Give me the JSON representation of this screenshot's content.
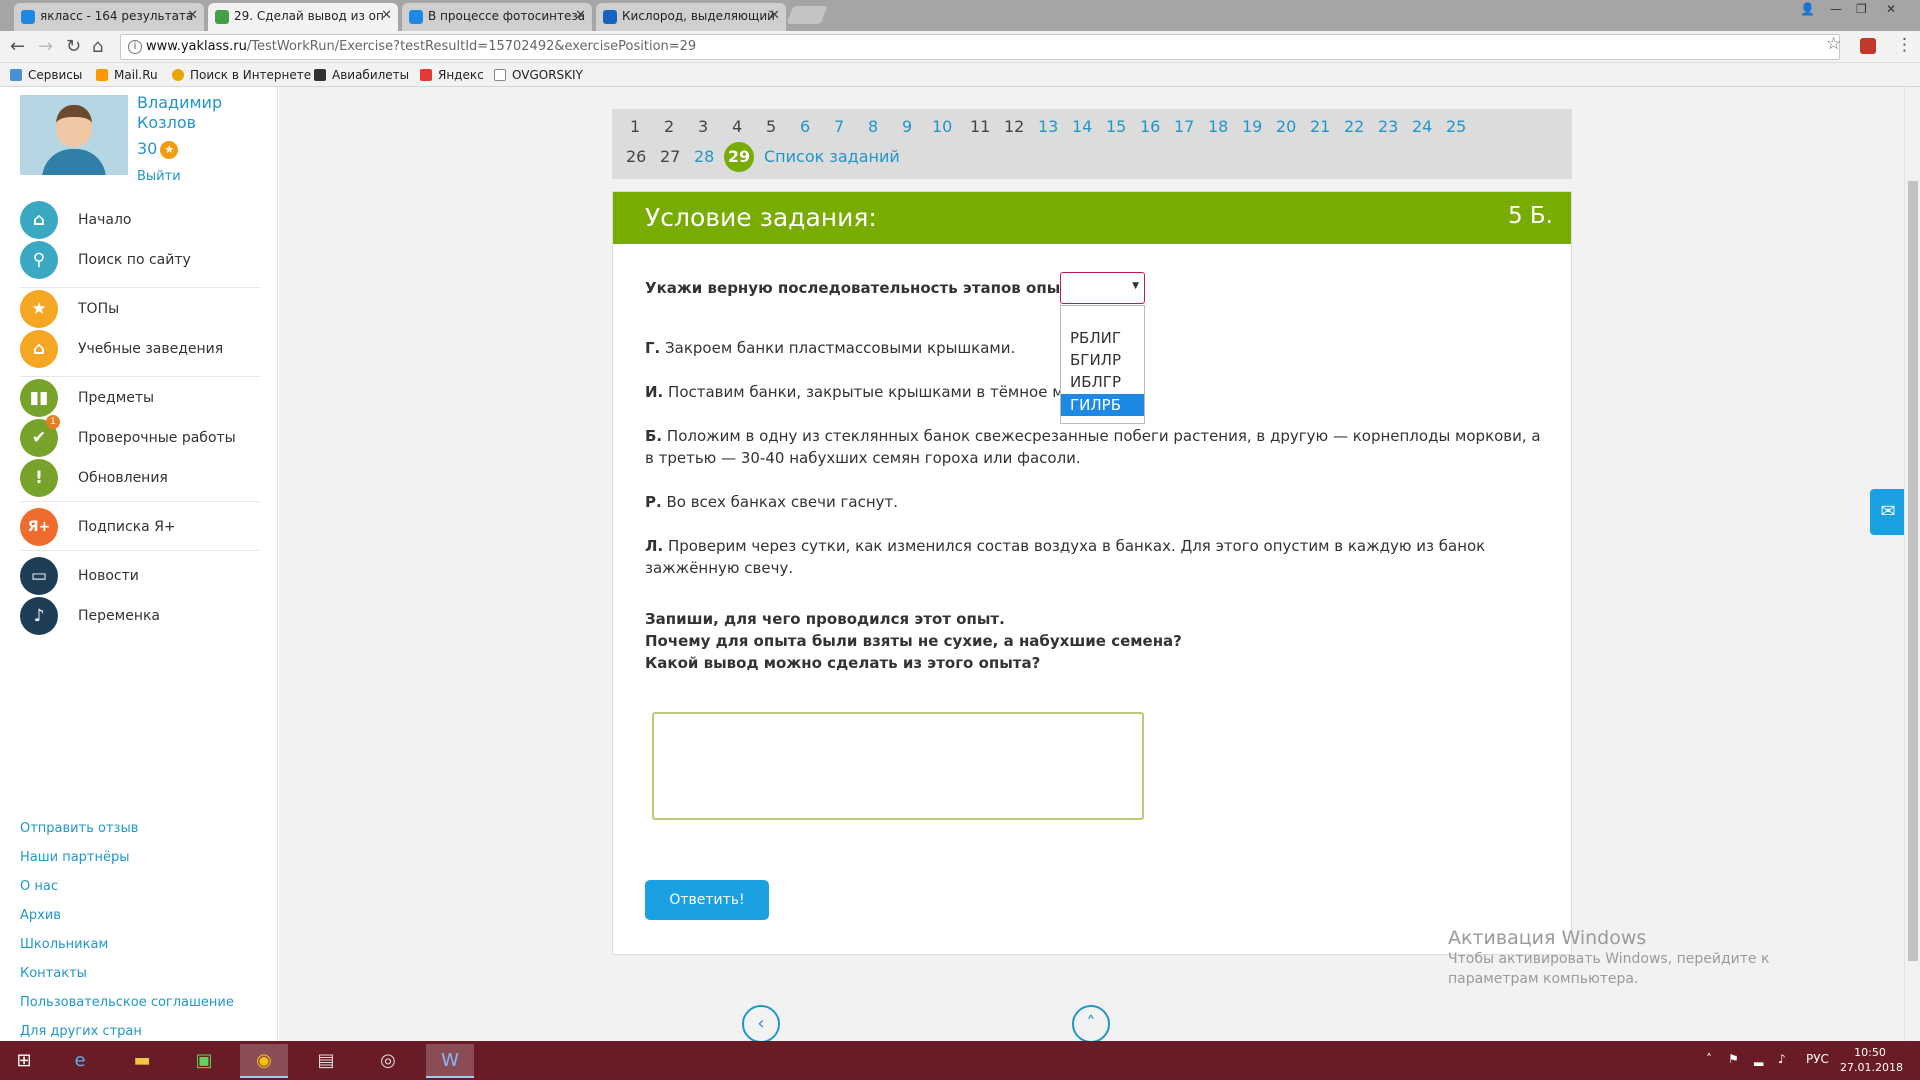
{
  "browser": {
    "tabs": [
      {
        "title": "яклacc - 164 результата",
        "active": false
      },
      {
        "title": "29. Сделай вывод из оп",
        "active": true
      },
      {
        "title": "В процессе фотосинтеза",
        "active": false
      },
      {
        "title": "Кислород, выделяющий",
        "active": false
      }
    ],
    "url_host": "www.yaklass.ru",
    "url_path": "/TestWorkRun/Exercise?testResultId=15702492&exercisePosition=29",
    "bookmarks": [
      "Сервисы",
      "Mail.Ru",
      "Поиск в Интернете",
      "Авиабилеты",
      "Яндекс",
      "OVGORSKIY"
    ]
  },
  "user": {
    "first_name": "Владимир",
    "last_name": "Козлов",
    "points": "30",
    "logout": "Выйти"
  },
  "sidebar": {
    "items": [
      {
        "label": "Начало",
        "icon": "home-icon",
        "color": "#3aa8c1"
      },
      {
        "label": "Поиск по сайту",
        "icon": "search-icon",
        "color": "#3aa8c1"
      },
      {
        "label": "ТОПы",
        "icon": "star-icon",
        "color": "#f5a623"
      },
      {
        "label": "Учебные заведения",
        "icon": "school-icon",
        "color": "#f5a623"
      },
      {
        "label": "Предметы",
        "icon": "book-icon",
        "color": "#78a32b"
      },
      {
        "label": "Проверочные работы",
        "icon": "check-icon",
        "color": "#78a32b",
        "badge": "1"
      },
      {
        "label": "Обновления",
        "icon": "exclamation-icon",
        "color": "#78a32b"
      },
      {
        "label": "Подписка Я+",
        "icon": "ya-plus-icon",
        "color": "#ef6c2d"
      },
      {
        "label": "Новости",
        "icon": "chat-icon",
        "color": "#1f3d56"
      },
      {
        "label": "Переменка",
        "icon": "bell-icon",
        "color": "#1f3d56"
      }
    ],
    "footer_links": [
      "Отправить отзыв",
      "Наши партнёры",
      "О нас",
      "Архив",
      "Школьникам",
      "Контакты",
      "Пользовательское соглашение",
      "Для других стран"
    ]
  },
  "pager": {
    "row1": [
      "1",
      "2",
      "3",
      "4",
      "5",
      "6",
      "7",
      "8",
      "9",
      "10",
      "11",
      "12",
      "13",
      "14",
      "15",
      "16",
      "17",
      "18",
      "19",
      "20",
      "21",
      "22",
      "23",
      "24",
      "25"
    ],
    "row2": [
      "26",
      "27",
      "28"
    ],
    "current": "29",
    "task_list": "Список заданий"
  },
  "task": {
    "header": "Условие задания:",
    "points": "5 Б.",
    "prompt": "Укажи верную последовательность этапов опыта:",
    "select_value": "",
    "options": [
      "РБЛИГ",
      "БГИЛР",
      "ИБЛГР",
      "ГИЛРБ"
    ],
    "highlighted_option": "ГИЛРБ",
    "steps": [
      {
        "letter": "Г.",
        "text": "Закроем банки пластмассовыми крышками."
      },
      {
        "letter": "И.",
        "text": "Поставим банки, закрытые крышками в тёмное ме"
      },
      {
        "letter": "Б.",
        "text": "Положим в одну из стеклянных банок свежесрезанные побеги растения, в другую — корнеплоды моркови, а в третью — 30-40 набухших семян гороха или фасоли."
      },
      {
        "letter": "Р.",
        "text": "Во всех банках свечи гаснут."
      },
      {
        "letter": "Л.",
        "text": "Проверим через сутки, как изменился состав воздуха в банках. Для этого опустим в каждую из банок зажжённую свечу."
      }
    ],
    "questions": [
      "Запиши, для чего проводился этот опыт.",
      "Почему для опыта были взяты не сухие, а набухшие семена?",
      "Какой вывод можно сделать из этого опыта?"
    ],
    "answer_value": "",
    "submit": "Ответить!"
  },
  "watermark": {
    "title": "Активация Windows",
    "text": "Чтобы активировать Windows, перейдите к параметрам компьютера."
  },
  "taskbar": {
    "lang": "РУС",
    "time": "10:50",
    "date": "27.01.2018"
  },
  "colors": {
    "accent": "#78ac00",
    "link": "#2196c9",
    "button": "#1ba1e2",
    "taskbar": "#6a1c26"
  }
}
